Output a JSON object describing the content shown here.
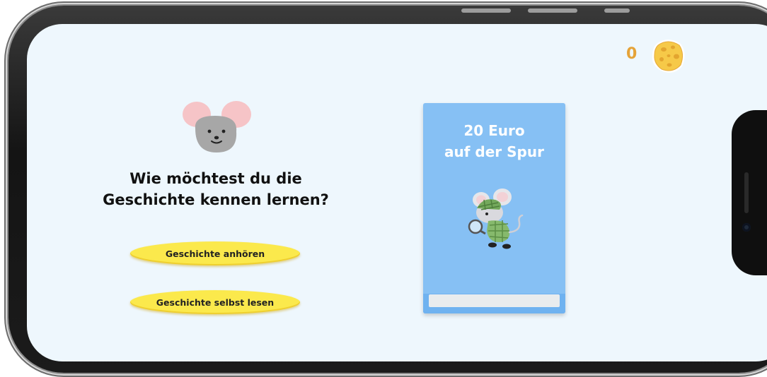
{
  "score": {
    "value": "0",
    "icon": "cheese-icon"
  },
  "prompt": {
    "line1": "Wie möchtest du die",
    "line2": "Geschichte kennen lernen?"
  },
  "options": {
    "listen_label": "Geschichte anhören",
    "read_label": "Geschichte selbst lesen"
  },
  "book": {
    "title_line1": "20 Euro",
    "title_line2": "auf der Spur",
    "cover_color": "#86c0f4"
  },
  "colors": {
    "background": "#eef7fd",
    "button": "#fbe94c",
    "score": "#e5a338"
  }
}
